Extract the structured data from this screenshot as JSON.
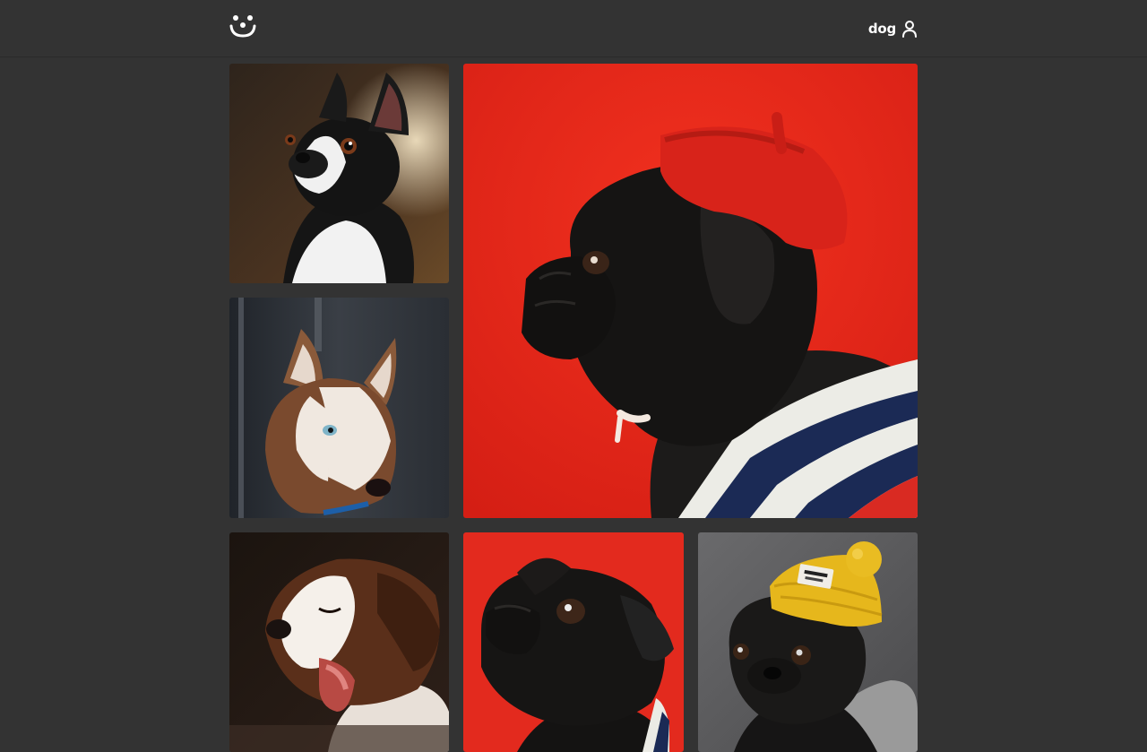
{
  "header": {
    "logo_icon": "paw-face-icon",
    "username": "dog",
    "user_icon": "user-icon"
  },
  "gallery": {
    "photos": [
      {
        "subject": "boston-terrier",
        "background": "#3a2a1e"
      },
      {
        "subject": "pug-red-beret",
        "background": "#e8261f"
      },
      {
        "subject": "husky",
        "background": "#2b2f36"
      },
      {
        "subject": "yawning-puppy",
        "background": "#2a1c14"
      },
      {
        "subject": "pug-red-background",
        "background": "#e32a1e"
      },
      {
        "subject": "pug-yellow-beanie",
        "background": "#5a5a5c"
      }
    ]
  }
}
